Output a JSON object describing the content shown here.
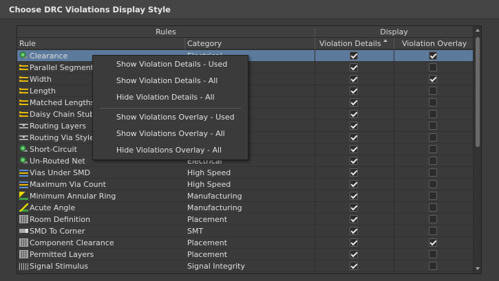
{
  "window": {
    "title": "Choose DRC Violations Display Style"
  },
  "grid": {
    "group_headers": {
      "rules": "Rules",
      "display": "Display"
    },
    "columns": {
      "rule": "Rule",
      "category": "Category",
      "violation_details": "Violation Details",
      "violation_overlay": "Violation Overlay"
    },
    "rows": [
      {
        "icon": "short-circuit-icon",
        "name": "Clearance",
        "category": "Electrical",
        "details": true,
        "overlay": true,
        "selected": true
      },
      {
        "icon": "parallel-segment-icon",
        "name": "Parallel Segment",
        "category": "",
        "details": true,
        "overlay": false
      },
      {
        "icon": "width-icon",
        "name": "Width",
        "category": "",
        "details": true,
        "overlay": true
      },
      {
        "icon": "length-icon",
        "name": "Length",
        "category": "",
        "details": true,
        "overlay": false
      },
      {
        "icon": "matched-lengths-icon",
        "name": "Matched Lengths",
        "category": "",
        "details": true,
        "overlay": false
      },
      {
        "icon": "daisy-chain-icon",
        "name": "Daisy Chain Stub",
        "category": "",
        "details": true,
        "overlay": false
      },
      {
        "icon": "routing-layers-icon",
        "name": "Routing Layers",
        "category": "",
        "details": true,
        "overlay": false
      },
      {
        "icon": "routing-via-style-icon",
        "name": "Routing Via Style",
        "category": "",
        "details": true,
        "overlay": false
      },
      {
        "icon": "short-circuit-icon",
        "name": "Short-Circuit",
        "category": "",
        "details": true,
        "overlay": false
      },
      {
        "icon": "un-routed-net-icon",
        "name": "Un-Routed Net",
        "category": "Electrical",
        "details": true,
        "overlay": false
      },
      {
        "icon": "vias-under-smd-icon",
        "name": "Vias Under SMD",
        "category": "High Speed",
        "details": true,
        "overlay": false
      },
      {
        "icon": "maximum-via-count-icon",
        "name": "Maximum Via Count",
        "category": "High Speed",
        "details": true,
        "overlay": false
      },
      {
        "icon": "annular-ring-icon",
        "name": "Minimum Annular Ring",
        "category": "Manufacturing",
        "details": true,
        "overlay": false
      },
      {
        "icon": "acute-angle-icon",
        "name": "Acute Angle",
        "category": "Manufacturing",
        "details": true,
        "overlay": false
      },
      {
        "icon": "room-definition-icon",
        "name": "Room Definition",
        "category": "Placement",
        "details": true,
        "overlay": false
      },
      {
        "icon": "smd-to-corner-icon",
        "name": "SMD To Corner",
        "category": "SMT",
        "details": true,
        "overlay": false
      },
      {
        "icon": "component-clearance-icon",
        "name": "Component Clearance",
        "category": "Placement",
        "details": true,
        "overlay": true
      },
      {
        "icon": "permitted-layers-icon",
        "name": "Permitted Layers",
        "category": "Placement",
        "details": true,
        "overlay": false
      },
      {
        "icon": "signal-stimulus-icon",
        "name": "Signal Stimulus",
        "category": "Signal Integrity",
        "details": true,
        "overlay": false
      }
    ]
  },
  "context_menu": {
    "items": [
      "Show Violation Details - Used",
      "Show Violation Details - All",
      "Hide Violation Details - All",
      "Show Violations Overlay - Used",
      "Show Violations Overlay - All",
      "Hide Violations Overlay - All"
    ]
  },
  "colors": {
    "selection": "#5c7a9c",
    "background": "#3c3c3c"
  }
}
